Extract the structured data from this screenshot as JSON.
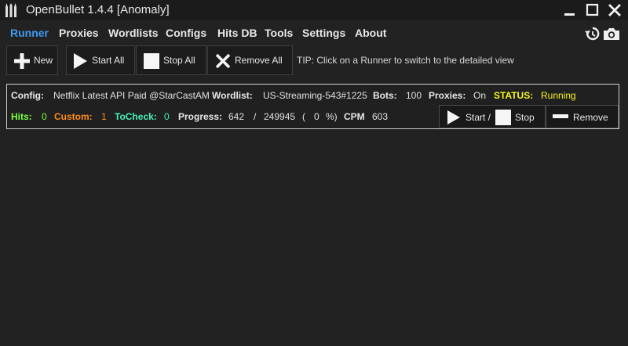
{
  "window": {
    "title": "OpenBullet 1.4.4 [Anomaly]"
  },
  "menu": {
    "items": [
      "Runner",
      "Proxies",
      "Wordlists",
      "Configs",
      "Hits DB",
      "Tools",
      "Settings",
      "About"
    ],
    "active": "Runner"
  },
  "toolbar": {
    "new_label": "New",
    "start_all_label": "Start All",
    "stop_all_label": "Stop All",
    "remove_all_label": "Remove All",
    "tip": "TIP: Click on a Runner to switch to the detailed view"
  },
  "runner": {
    "config_label": "Config:",
    "config_value": "Netflix Latest API Paid @StarCastAM",
    "wordlist_label": "Wordlist:",
    "wordlist_value": "US-Streaming-543#1225",
    "bots_label": "Bots:",
    "bots_value": "100",
    "proxies_label": "Proxies:",
    "proxies_value": "On",
    "status_label": "STATUS:",
    "status_value": "Running",
    "hits_label": "Hits:",
    "hits_value": "0",
    "custom_label": "Custom:",
    "custom_value": "1",
    "tocheck_label": "ToCheck:",
    "tocheck_value": "0",
    "progress_label": "Progress:",
    "progress_current": "642",
    "progress_sep": "/",
    "progress_total": "249945",
    "progress_paren_open": "(",
    "progress_percent": "0",
    "progress_paren_close": "%)",
    "cpm_label": "CPM",
    "cpm_value": "603",
    "start_label": "Start /",
    "stop_label": "Stop",
    "remove_label": "Remove"
  },
  "colors": {
    "background": "#222222",
    "menu_active": "#3d9bf0",
    "hits": "#7cff3c",
    "custom": "#ff8c1a",
    "tocheck": "#46f0b8",
    "status": "#f5f51e"
  }
}
